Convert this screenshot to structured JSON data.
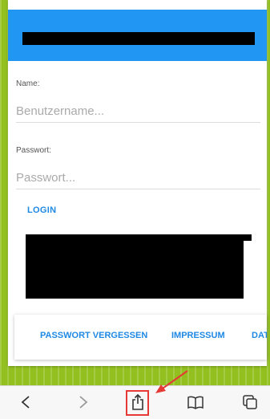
{
  "form": {
    "name_label": "Name:",
    "name_placeholder": "Benutzername...",
    "password_label": "Passwort:",
    "password_placeholder": "Passwort...",
    "login_label": "LOGIN"
  },
  "footer_links": {
    "forgot_password": "PASSWORT VERGESSEN",
    "impressum": "IMPRESSUM",
    "datenschutz_partial": "DAT"
  },
  "toolbar": {
    "icons": [
      "back-icon",
      "forward-icon",
      "share-icon",
      "bookmarks-icon",
      "tabs-icon"
    ]
  },
  "colors": {
    "header": "#2196f3",
    "accent": "#1e88e5",
    "background": "#93c01f",
    "highlight": "#e53935"
  }
}
